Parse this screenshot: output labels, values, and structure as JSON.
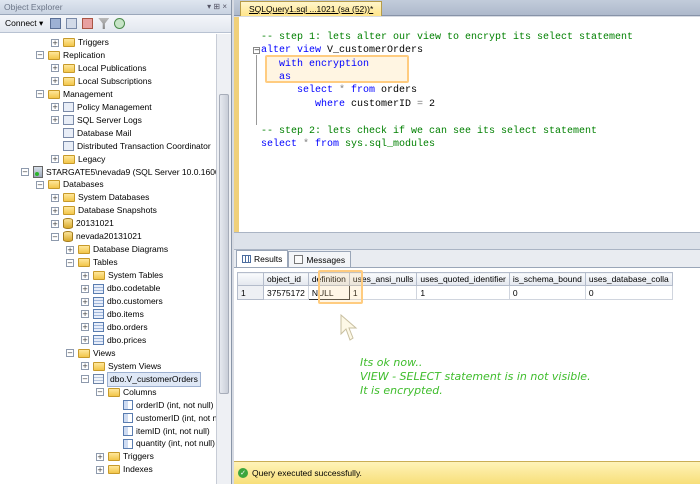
{
  "object_explorer": {
    "title": "Object Explorer",
    "pin_glyph": "▾ ⊞ ×",
    "toolbar": {
      "connect_label": "Connect ▾"
    },
    "tree": [
      {
        "label": "Triggers",
        "icon": "folder-icon",
        "exp": "+"
      },
      {
        "label": "Replication",
        "icon": "folder-icon",
        "exp": "−"
      },
      {
        "label": "Local Publications",
        "icon": "folder-icon",
        "exp": "+"
      },
      {
        "label": "Local Subscriptions",
        "icon": "folder-icon",
        "exp": "+"
      },
      {
        "label": "Management",
        "icon": "folder-icon",
        "exp": "−"
      },
      {
        "label": "Policy Management",
        "icon": "policy-icon",
        "exp": "+"
      },
      {
        "label": "SQL Server Logs",
        "icon": "logs-icon",
        "exp": "+"
      },
      {
        "label": "Database Mail",
        "icon": "mail-icon",
        "exp": ""
      },
      {
        "label": "Distributed Transaction Coordinator",
        "icon": "dtc-icon",
        "exp": ""
      },
      {
        "label": "Legacy",
        "icon": "folder-icon",
        "exp": "+"
      },
      {
        "label": "STARGATE5\\nevada9 (SQL Server 10.0.1600",
        "icon": "server-icon",
        "exp": "−"
      },
      {
        "label": "Databases",
        "icon": "folder-icon",
        "exp": "−"
      },
      {
        "label": "System Databases",
        "icon": "folder-icon",
        "exp": "+"
      },
      {
        "label": "Database Snapshots",
        "icon": "folder-icon",
        "exp": "+"
      },
      {
        "label": "20131021",
        "icon": "database-icon",
        "exp": "+"
      },
      {
        "label": "nevada20131021",
        "icon": "database-icon",
        "exp": "−"
      },
      {
        "label": "Database Diagrams",
        "icon": "folder-icon",
        "exp": "+"
      },
      {
        "label": "Tables",
        "icon": "folder-icon",
        "exp": "−"
      },
      {
        "label": "System Tables",
        "icon": "folder-icon",
        "exp": "+"
      },
      {
        "label": "dbo.codetable",
        "icon": "table-icon",
        "exp": "+"
      },
      {
        "label": "dbo.customers",
        "icon": "table-icon",
        "exp": "+"
      },
      {
        "label": "dbo.items",
        "icon": "table-icon",
        "exp": "+"
      },
      {
        "label": "dbo.orders",
        "icon": "table-icon",
        "exp": "+"
      },
      {
        "label": "dbo.prices",
        "icon": "table-icon",
        "exp": "+"
      },
      {
        "label": "Views",
        "icon": "folder-icon",
        "exp": "−"
      },
      {
        "label": "System Views",
        "icon": "folder-icon",
        "exp": "+"
      },
      {
        "label": "dbo.V_customerOrders",
        "icon": "view-icon",
        "exp": "−"
      },
      {
        "label": "Columns",
        "icon": "folder-icon",
        "exp": "−"
      },
      {
        "label": "orderID (int, not null)",
        "icon": "column-icon",
        "exp": ""
      },
      {
        "label": "customerID (int, not null)",
        "icon": "column-icon",
        "exp": ""
      },
      {
        "label": "itemID (int, not null)",
        "icon": "column-icon",
        "exp": ""
      },
      {
        "label": "quantity (int, not null)",
        "icon": "column-icon",
        "exp": ""
      },
      {
        "label": "Triggers",
        "icon": "folder-icon",
        "exp": "+"
      },
      {
        "label": "Indexes",
        "icon": "folder-icon",
        "exp": "+"
      }
    ]
  },
  "editor": {
    "tab_title": "SQLQuery1.sql ...1021 (sa (52))*",
    "code_lines": [
      {
        "parts": [
          {
            "t": "-- step 1: lets alter our view to encrypt its select statement",
            "c": "cmt"
          }
        ]
      },
      {
        "parts": [
          {
            "t": "alter view ",
            "c": "kw"
          },
          {
            "t": "V_customerOrders",
            "c": "pl"
          }
        ]
      },
      {
        "parts": [
          {
            "t": "   with encryption",
            "c": "kw"
          }
        ]
      },
      {
        "parts": [
          {
            "t": "   as",
            "c": "kw"
          }
        ]
      },
      {
        "parts": [
          {
            "t": "      select ",
            "c": "kw"
          },
          {
            "t": "* ",
            "c": "gr"
          },
          {
            "t": "from ",
            "c": "kw"
          },
          {
            "t": "orders",
            "c": "pl"
          }
        ]
      },
      {
        "parts": [
          {
            "t": "         where ",
            "c": "kw"
          },
          {
            "t": "customerID ",
            "c": "pl"
          },
          {
            "t": "= ",
            "c": "gr"
          },
          {
            "t": "2",
            "c": "pl"
          }
        ]
      },
      {
        "parts": [
          {
            "t": "",
            "c": "pl"
          }
        ]
      },
      {
        "parts": [
          {
            "t": "-- step 2: lets check if we can see its select statement",
            "c": "cmt"
          }
        ]
      },
      {
        "parts": [
          {
            "t": "select ",
            "c": "kw"
          },
          {
            "t": "* ",
            "c": "gr"
          },
          {
            "t": "from ",
            "c": "kw"
          },
          {
            "t": "sys.sql_modules",
            "c": "sys"
          }
        ]
      }
    ]
  },
  "results": {
    "tabs": [
      "Results",
      "Messages"
    ],
    "columns": [
      "",
      "object_id",
      "definition",
      "uses_ansi_nulls",
      "uses_quoted_identifier",
      "is_schema_bound",
      "uses_database_colla"
    ],
    "rows": [
      [
        "1",
        "37575172",
        "NULL",
        "1",
        "1",
        "0",
        "0"
      ]
    ]
  },
  "annotation": [
    "Its ok now..",
    "VIEW - SELECT statement is in not visible.",
    "It is encrypted."
  ],
  "status": {
    "text": "Query executed successfully.",
    "color": "#f7df7a"
  },
  "colors": {
    "comment": "#008000",
    "keyword": "#0000ff",
    "note": "#3fbd2c",
    "highlight": "#ffcc80"
  }
}
